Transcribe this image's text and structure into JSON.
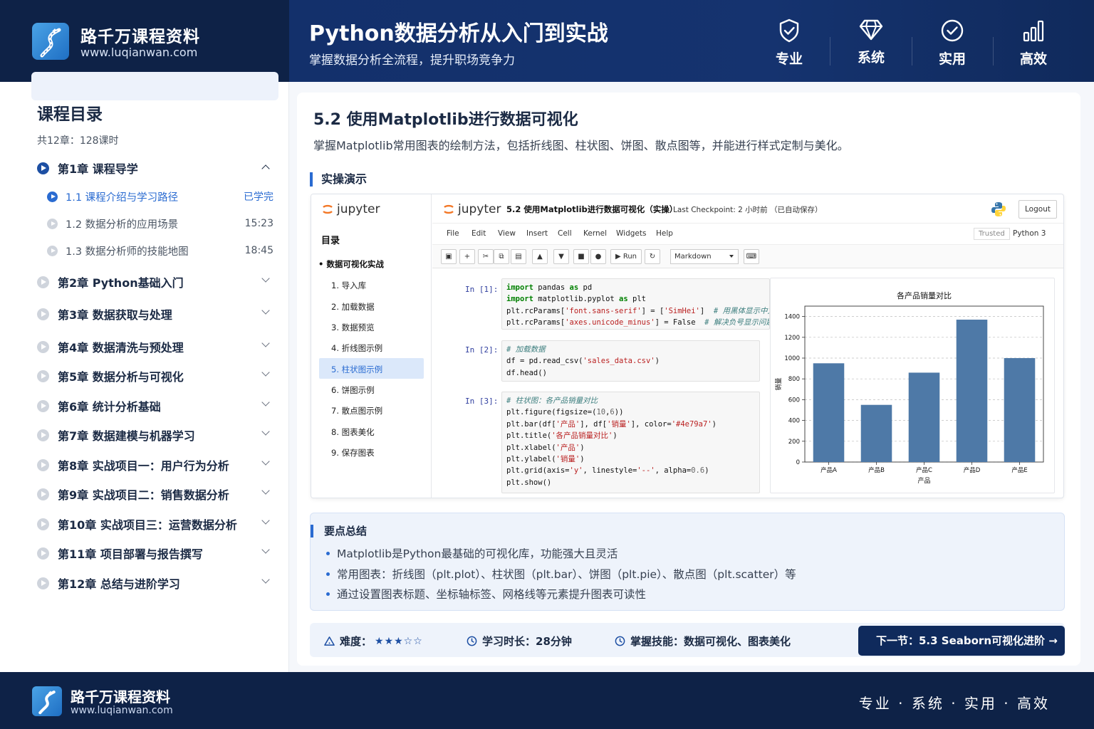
{
  "brand": {
    "name": "路千万课程资料",
    "url": "www.luqianwan.com"
  },
  "header": {
    "title": "Python数据分析从入门到实战",
    "subtitle": "掌握数据分析全流程，提升职场竞争力",
    "features": [
      {
        "label": "专业",
        "icon": "shield-check-icon"
      },
      {
        "label": "系统",
        "icon": "diamond-icon"
      },
      {
        "label": "实用",
        "icon": "check-circle-icon"
      },
      {
        "label": "高效",
        "icon": "bar-chart-icon"
      }
    ]
  },
  "sidebar": {
    "title": "课程目录",
    "meta": "共12章：128课时",
    "chapters": [
      {
        "label": "第1章 课程导学",
        "expanded": true
      },
      {
        "label": "第2章 Python基础入门"
      },
      {
        "label": "第3章 数据获取与处理"
      },
      {
        "label": "第4章 数据清洗与预处理"
      },
      {
        "label": "第5章 数据分析与可视化"
      },
      {
        "label": "第6章 统计分析基础"
      },
      {
        "label": "第7章 数据建模与机器学习"
      },
      {
        "label": "第8章 实战项目一：用户行为分析"
      },
      {
        "label": "第9章 实战项目二：销售数据分析"
      },
      {
        "label": "第10章 实战项目三：运营数据分析"
      },
      {
        "label": "第11章 项目部署与报告撰写"
      },
      {
        "label": "第12章 总结与进阶学习"
      }
    ],
    "lessons": [
      {
        "label": "1.1 课程介绍与学习路径",
        "right": "已学完",
        "active": true
      },
      {
        "label": "1.2 数据分析的应用场景",
        "right": "15:23"
      },
      {
        "label": "1.3 数据分析师的技能地图",
        "right": "18:45"
      }
    ]
  },
  "section": {
    "title": "5.2  使用Matplotlib进行数据可视化",
    "description": "掌握Matplotlib常用图表的绘制方法，包括折线图、柱状图、饼图、散点图等，并能进行样式定制与美化。",
    "demo_heading": "实操演示"
  },
  "jupyter": {
    "logo_text": "jupyter",
    "toc_title": "目录",
    "toc_root": "数据可视化实战",
    "toc_items": [
      "1. 导入库",
      "2. 加载数据",
      "3. 数据预览",
      "4. 折线图示例",
      "5. 柱状图示例",
      "6. 饼图示例",
      "7. 散点图示例",
      "8. 图表美化",
      "9. 保存图表"
    ],
    "notebook_name": "5.2 使用Matplotlib进行数据可视化（实操）",
    "checkpoint": "Last Checkpoint: 2 小时前 （已自动保存）",
    "logout": "Logout",
    "menu": [
      "File",
      "Edit",
      "View",
      "Insert",
      "Cell",
      "Kernel",
      "Widgets",
      "Help"
    ],
    "trusted": "Trusted",
    "kernel": "Python 3",
    "run_label": "Run",
    "cell_type": "Markdown",
    "prompts": [
      "In [1]:",
      "In [2]:",
      "In [3]:"
    ],
    "cell1": [
      "import pandas as pd",
      "import matplotlib.pyplot as plt",
      "plt.rcParams['font.sans-serif'] = ['SimHei']",
      "plt.rcParams['axes.unicode_minus'] = False"
    ],
    "cell1_comments": [
      "# 用黑体显示中文",
      "# 解决负号显示问题"
    ],
    "cell2": [
      "# 加载数据",
      "df = pd.read_csv('sales_data.csv')",
      "df.head()"
    ],
    "cell3": [
      "# 柱状图：各产品销量对比",
      "plt.figure(figsize=(10,6))",
      "plt.bar(df['产品'], df['销量'], color='#4e79a7')",
      "plt.title('各产品销量对比')",
      "plt.xlabel('产品')",
      "plt.ylabel('销量')",
      "plt.grid(axis='y', linestyle='--', alpha=0.6)",
      "plt.show()"
    ]
  },
  "chart_data": {
    "type": "bar",
    "title": "各产品销量对比",
    "xlabel": "产品",
    "ylabel": "销量",
    "categories": [
      "产品A",
      "产品B",
      "产品C",
      "产品D",
      "产品E"
    ],
    "values": [
      950,
      550,
      860,
      1370,
      1000
    ],
    "ylim": [
      0,
      1500
    ],
    "yticks": [
      0,
      200,
      400,
      600,
      800,
      1000,
      1200,
      1400
    ],
    "grid": "y dashed",
    "color": "#4e79a7"
  },
  "summary": {
    "heading": "要点总结",
    "points": [
      "Matplotlib是Python最基础的可视化库，功能强大且灵活",
      "常用图表：折线图（plt.plot）、柱状图（plt.bar）、饼图（plt.pie）、散点图（plt.scatter）等",
      "通过设置图表标题、坐标轴标签、网格线等元素提升图表可读性"
    ]
  },
  "bottom": {
    "difficulty_label": "难度：",
    "difficulty_stars": "★★★☆☆",
    "difficulty_value": 3,
    "duration": "学习时长：28分钟",
    "skills": "掌握技能：数据可视化、图表美化",
    "next": "下一节：5.3 Seaborn可视化进阶 →"
  },
  "footer": {
    "slogan": "专业 · 系统 · 实用 · 高效"
  },
  "colors": {
    "navy": "#0e2247",
    "accent": "#2a6bd1",
    "bar": "#4e79a7"
  }
}
